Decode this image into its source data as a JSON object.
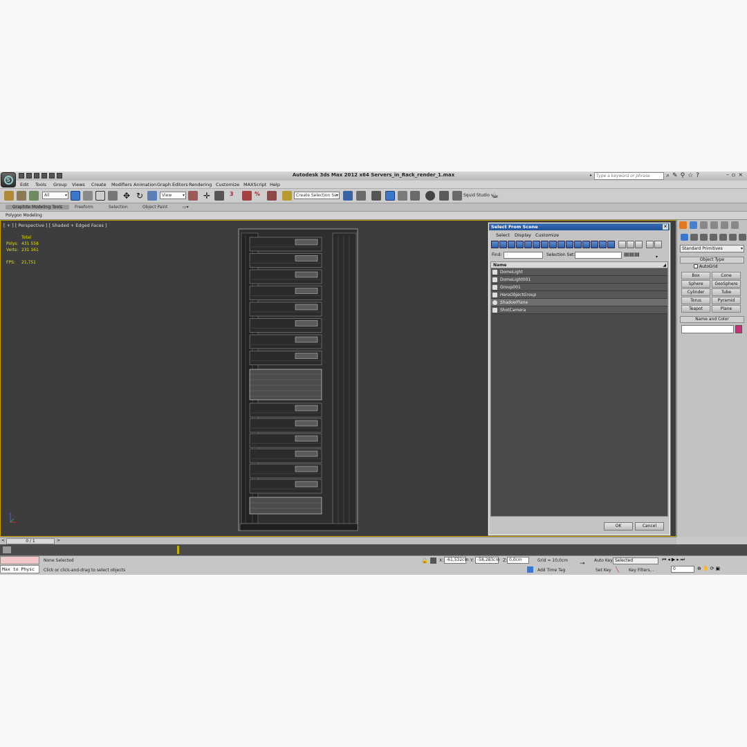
{
  "app": {
    "title": "Autodesk 3ds Max  2012 x64     Servers_in_Rack_render_1.max",
    "search_placeholder": "Type a keyword or phrase",
    "logo_glyph": "S"
  },
  "menu": [
    "Edit",
    "Tools",
    "Group",
    "Views",
    "Create",
    "Modifiers",
    "Animation",
    "Graph Editors",
    "Rendering",
    "Customize",
    "MAXScript",
    "Help"
  ],
  "toolbar": {
    "filter_value": "All",
    "refcoord_value": "View",
    "angle_snap_label": "3",
    "selection_set_value": "Create Selection Se",
    "studio_label": "Squid Studio v"
  },
  "ribbon": {
    "tabs": [
      "Graphite Modeling Tools",
      "Freeform",
      "Selection",
      "Object Paint"
    ],
    "active_tab": "Graphite Modeling Tools",
    "sub_label": "Polygon Modeling"
  },
  "viewport": {
    "label": "[ + ] [ Perspective ] [ Shaded + Edged Faces ]",
    "stats": {
      "header": "Total",
      "polys_label": "Polys:",
      "polys_value": "431 558",
      "verts_label": "Verts:",
      "verts_value": "231 161",
      "fps_label": "FPS:",
      "fps_value": "21,751"
    }
  },
  "dialog": {
    "title": "Select From Scene",
    "menu": [
      "Select",
      "Display",
      "Customize"
    ],
    "find_label": "Find:",
    "selection_set_label": "Selection Set:",
    "column_header": "Name",
    "rows": [
      {
        "name": "DomeLight",
        "icon": "light-icon",
        "italic": false,
        "selected": false
      },
      {
        "name": "DomeLight001",
        "icon": "light-icon",
        "italic": false,
        "selected": false
      },
      {
        "name": "Group001",
        "icon": "group-icon",
        "italic": false,
        "selected": false
      },
      {
        "name": "HeroObjectGroup",
        "icon": "group-icon",
        "italic": true,
        "selected": false
      },
      {
        "name": "ShadowPlane",
        "icon": "geometry-icon",
        "italic": true,
        "selected": true
      },
      {
        "name": "ShotCamera",
        "icon": "camera-icon",
        "italic": false,
        "selected": false
      }
    ],
    "ok_label": "OK",
    "cancel_label": "Cancel"
  },
  "command_panel": {
    "category": "Standard Primitives",
    "object_type_label": "Object Type",
    "autogrid_label": "AutoGrid",
    "buttons": [
      "Box",
      "Cone",
      "Sphere",
      "GeoSphere",
      "Cylinder",
      "Tube",
      "Torus",
      "Pyramid",
      "Teapot",
      "Plane"
    ],
    "name_color_label": "Name and Color",
    "color": "#c8307a"
  },
  "timeline": {
    "frame_label": "0 / 1"
  },
  "status": {
    "maxscript_text": "Max to Physc",
    "selection_text": "None Selected",
    "prompt_text": "Click or click-and-drag to select objects",
    "x_label": "X:",
    "x_value": "-61,532cm",
    "y_label": "Y:",
    "y_value": "-58,283cm",
    "z_label": "Z:",
    "z_value": "0,0cm",
    "grid_text": "Grid = 10,0cm",
    "add_time_tag": "Add Time Tag",
    "auto_key": "Auto Key",
    "set_key": "Set Key",
    "selected_value": "Selected",
    "key_filters": "Key Filters...",
    "frame_value": "0"
  },
  "colors": {
    "viewport_bg": "#3d3d3d",
    "dialog_title": "#1f4f98",
    "stats_text": "#e8e000",
    "viewport_border": "#c8a000"
  }
}
